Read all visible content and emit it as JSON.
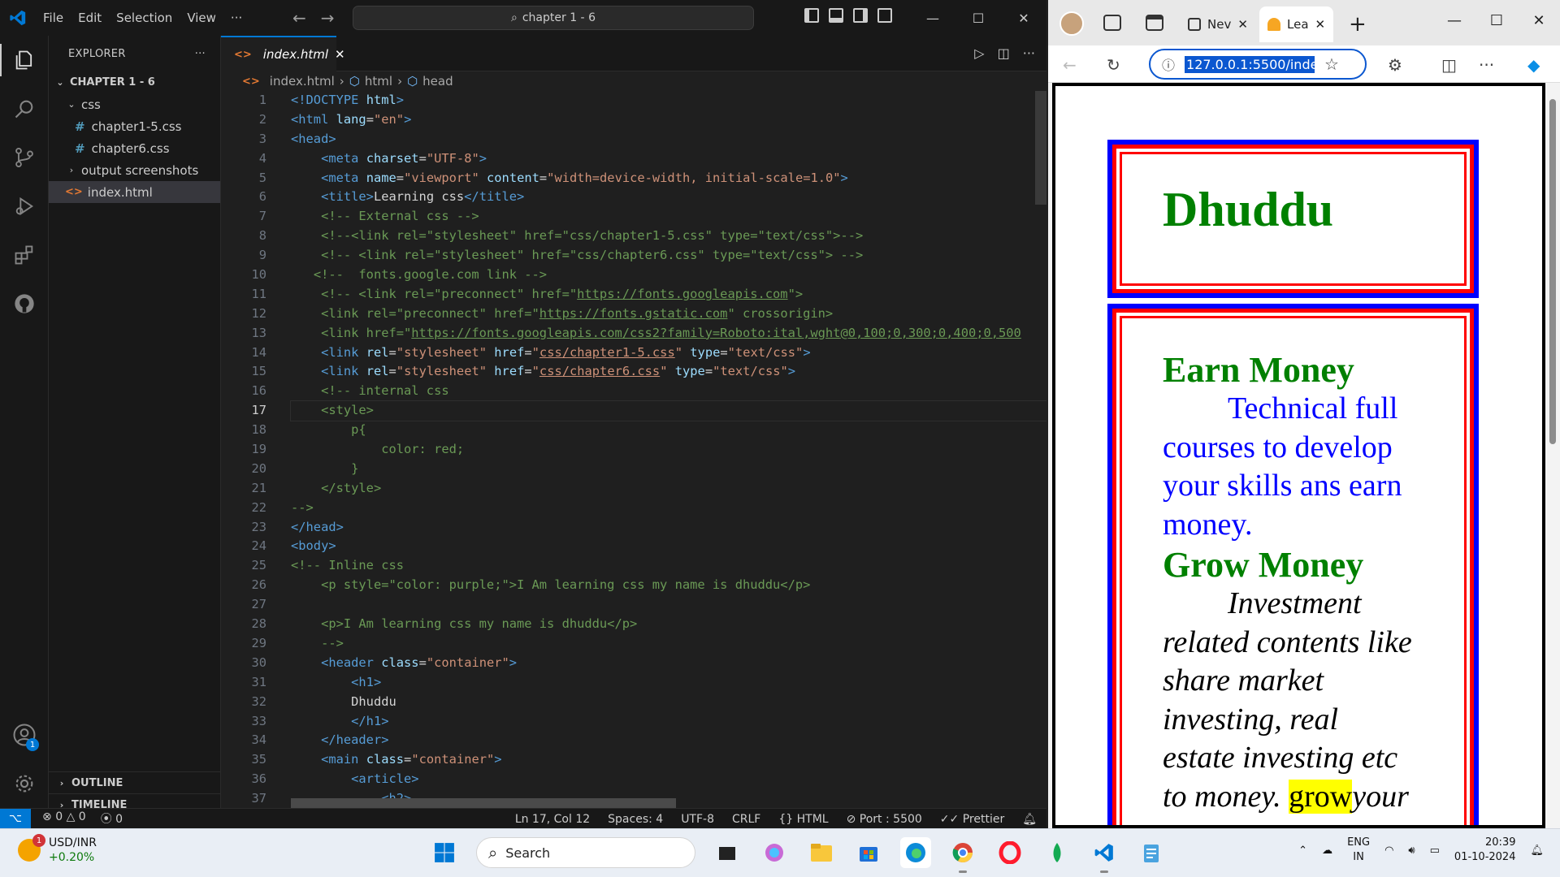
{
  "vscode": {
    "menu": [
      "File",
      "Edit",
      "Selection",
      "View",
      "···"
    ],
    "command_center": "chapter 1 - 6",
    "explorer": {
      "title": "EXPLORER",
      "project": "CHAPTER 1 - 6",
      "folder_css": "css",
      "file_css1": "chapter1-5.css",
      "file_css2": "chapter6.css",
      "folder_screens": "output screenshots",
      "file_html": "index.html",
      "outline": "OUTLINE",
      "timeline": "TIMELINE"
    },
    "accounts_badge": "1",
    "tab": {
      "label": "index.html"
    },
    "breadcrumb": [
      "index.html",
      "html",
      "head"
    ],
    "code_lines": [
      {
        "n": "1",
        "h": "<span class='tg'>&lt;!DOCTYPE</span> <span class='at'>html</span><span class='tg'>&gt;</span>"
      },
      {
        "n": "2",
        "h": "<span class='tg'>&lt;html</span> <span class='at'>lang</span><span class='tx'>=</span><span class='st'>\"en\"</span><span class='tg'>&gt;</span>"
      },
      {
        "n": "3",
        "h": "<span class='tg'>&lt;head&gt;</span>"
      },
      {
        "n": "4",
        "h": "    <span class='tg'>&lt;meta</span> <span class='at'>charset</span><span class='tx'>=</span><span class='st'>\"UTF-8\"</span><span class='tg'>&gt;</span>"
      },
      {
        "n": "5",
        "h": "    <span class='tg'>&lt;meta</span> <span class='at'>name</span><span class='tx'>=</span><span class='st'>\"viewport\"</span> <span class='at'>content</span><span class='tx'>=</span><span class='st'>\"width=device-width, initial-scale=1.0\"</span><span class='tg'>&gt;</span>"
      },
      {
        "n": "6",
        "h": "    <span class='tg'>&lt;title&gt;</span><span class='tx'>Learning css</span><span class='tg'>&lt;/title&gt;</span>"
      },
      {
        "n": "7",
        "h": "    <span class='cm'>&lt;!-- External css --&gt;</span>"
      },
      {
        "n": "8",
        "h": "    <span class='cm'>&lt;!--&lt;link rel=\"stylesheet\" href=\"css/chapter1-5.css\" type=\"text/css\"&gt;--&gt;</span>"
      },
      {
        "n": "9",
        "h": "    <span class='cm'>&lt;!-- &lt;link rel=\"stylesheet\" href=\"css/chapter6.css\" type=\"text/css\"&gt; --&gt;</span>"
      },
      {
        "n": "10",
        "h": "   <span class='cm'>&lt;!--  fonts.google.com link --&gt;</span>"
      },
      {
        "n": "11",
        "h": "    <span class='cm'>&lt;!-- &lt;link rel=\"preconnect\" href=\"<span class='ul'>https://fonts.googleapis.com</span>\"&gt;</span>"
      },
      {
        "n": "12",
        "h": "    <span class='cm'>&lt;link rel=\"preconnect\" href=\"<span class='ul'>https://fonts.gstatic.com</span>\" crossorigin&gt;</span>"
      },
      {
        "n": "13",
        "h": "    <span class='cm'>&lt;link href=\"<span class='ul'>https://fonts.googleapis.com/css2?family=Roboto:ital,wght@0,100;0,300;0,400;0,500</span></span>"
      },
      {
        "n": "14",
        "h": "    <span class='tg'>&lt;link</span> <span class='at'>rel</span><span class='tx'>=</span><span class='st'>\"stylesheet\"</span> <span class='at'>href</span><span class='tx'>=</span><span class='st'>\"<span class='ul'>css/chapter1-5.css</span>\"</span> <span class='at'>type</span><span class='tx'>=</span><span class='st'>\"text/css\"</span><span class='tg'>&gt;</span>"
      },
      {
        "n": "15",
        "h": "    <span class='tg'>&lt;link</span> <span class='at'>rel</span><span class='tx'>=</span><span class='st'>\"stylesheet\"</span> <span class='at'>href</span><span class='tx'>=</span><span class='st'>\"<span class='ul'>css/chapter6.css</span>\"</span> <span class='at'>type</span><span class='tx'>=</span><span class='st'>\"text/css\"</span><span class='tg'>&gt;</span>"
      },
      {
        "n": "16",
        "h": "    <span class='cm'>&lt;!-- internal css</span>"
      },
      {
        "n": "17",
        "h": "    <span class='cm'>&lt;style&gt;</span>",
        "cur": true
      },
      {
        "n": "18",
        "h": "        <span class='cm'>p{</span>"
      },
      {
        "n": "19",
        "h": "            <span class='cm'>color: red;</span>"
      },
      {
        "n": "20",
        "h": "        <span class='cm'>}</span>"
      },
      {
        "n": "21",
        "h": "    <span class='cm'>&lt;/style&gt;</span>"
      },
      {
        "n": "22",
        "h": "<span class='cm'>--&gt;</span>"
      },
      {
        "n": "23",
        "h": "<span class='tg'>&lt;/head&gt;</span>"
      },
      {
        "n": "24",
        "h": "<span class='tg'>&lt;body&gt;</span>"
      },
      {
        "n": "25",
        "h": "<span class='cm'>&lt;!-- Inline css</span>"
      },
      {
        "n": "26",
        "h": "    <span class='cm'>&lt;p style=\"color: purple;\"&gt;I Am learning css my name is dhuddu&lt;/p&gt;</span>"
      },
      {
        "n": "27",
        "h": ""
      },
      {
        "n": "28",
        "h": "    <span class='cm'>&lt;p&gt;I Am learning css my name is dhuddu&lt;/p&gt;</span>"
      },
      {
        "n": "29",
        "h": "    <span class='cm'>--&gt;</span>"
      },
      {
        "n": "30",
        "h": "    <span class='tg'>&lt;header</span> <span class='at'>class</span><span class='tx'>=</span><span class='st'>\"container\"</span><span class='tg'>&gt;</span>"
      },
      {
        "n": "31",
        "h": "        <span class='tg'>&lt;h1&gt;</span>"
      },
      {
        "n": "32",
        "h": "        <span class='tx'>Dhuddu</span>"
      },
      {
        "n": "33",
        "h": "        <span class='tg'>&lt;/h1&gt;</span>"
      },
      {
        "n": "34",
        "h": "    <span class='tg'>&lt;/header&gt;</span>"
      },
      {
        "n": "35",
        "h": "    <span class='tg'>&lt;main</span> <span class='at'>class</span><span class='tx'>=</span><span class='st'>\"container\"</span><span class='tg'>&gt;</span>"
      },
      {
        "n": "36",
        "h": "        <span class='tg'>&lt;article&gt;</span>"
      },
      {
        "n": "37",
        "h": "            <span class='tg'>&lt;h2&gt;</span>"
      }
    ],
    "status": {
      "errors": "0",
      "warnings": "0",
      "ports": "0",
      "position": "Ln 17, Col 12",
      "spaces": "Spaces: 4",
      "encoding": "UTF-8",
      "eol": "CRLF",
      "language": "HTML",
      "port": "Port : 5500",
      "formatter": "Prettier"
    }
  },
  "edge": {
    "tab1": "Nev",
    "tab2": "Lea",
    "url": "127.0.0.1:5500/inde",
    "page": {
      "h1": "Dhuddu",
      "h2_1": "Earn Money",
      "p1_lines": [
        "Technical full",
        "courses to develop",
        "your skills ans earn",
        "money."
      ],
      "h2_2": "Grow Money",
      "p2_lines": [
        "Investment",
        "related contents like",
        "share market",
        "investing, real",
        "estate investing etc",
        "to money. "
      ],
      "p2_highlight": "grow",
      "p2_tail": "your"
    },
    "colors": {
      "border_outer": "#0000ff",
      "border_inner": "#ff0000",
      "heading": "#008000",
      "para1": "#0000ff"
    }
  },
  "taskbar": {
    "stock_name": "USD/INR",
    "stock_change": "+0.20%",
    "stock_badge": "1",
    "search_placeholder": "Search",
    "lang1": "ENG",
    "lang2": "IN",
    "time": "20:39",
    "date": "01-10-2024"
  }
}
